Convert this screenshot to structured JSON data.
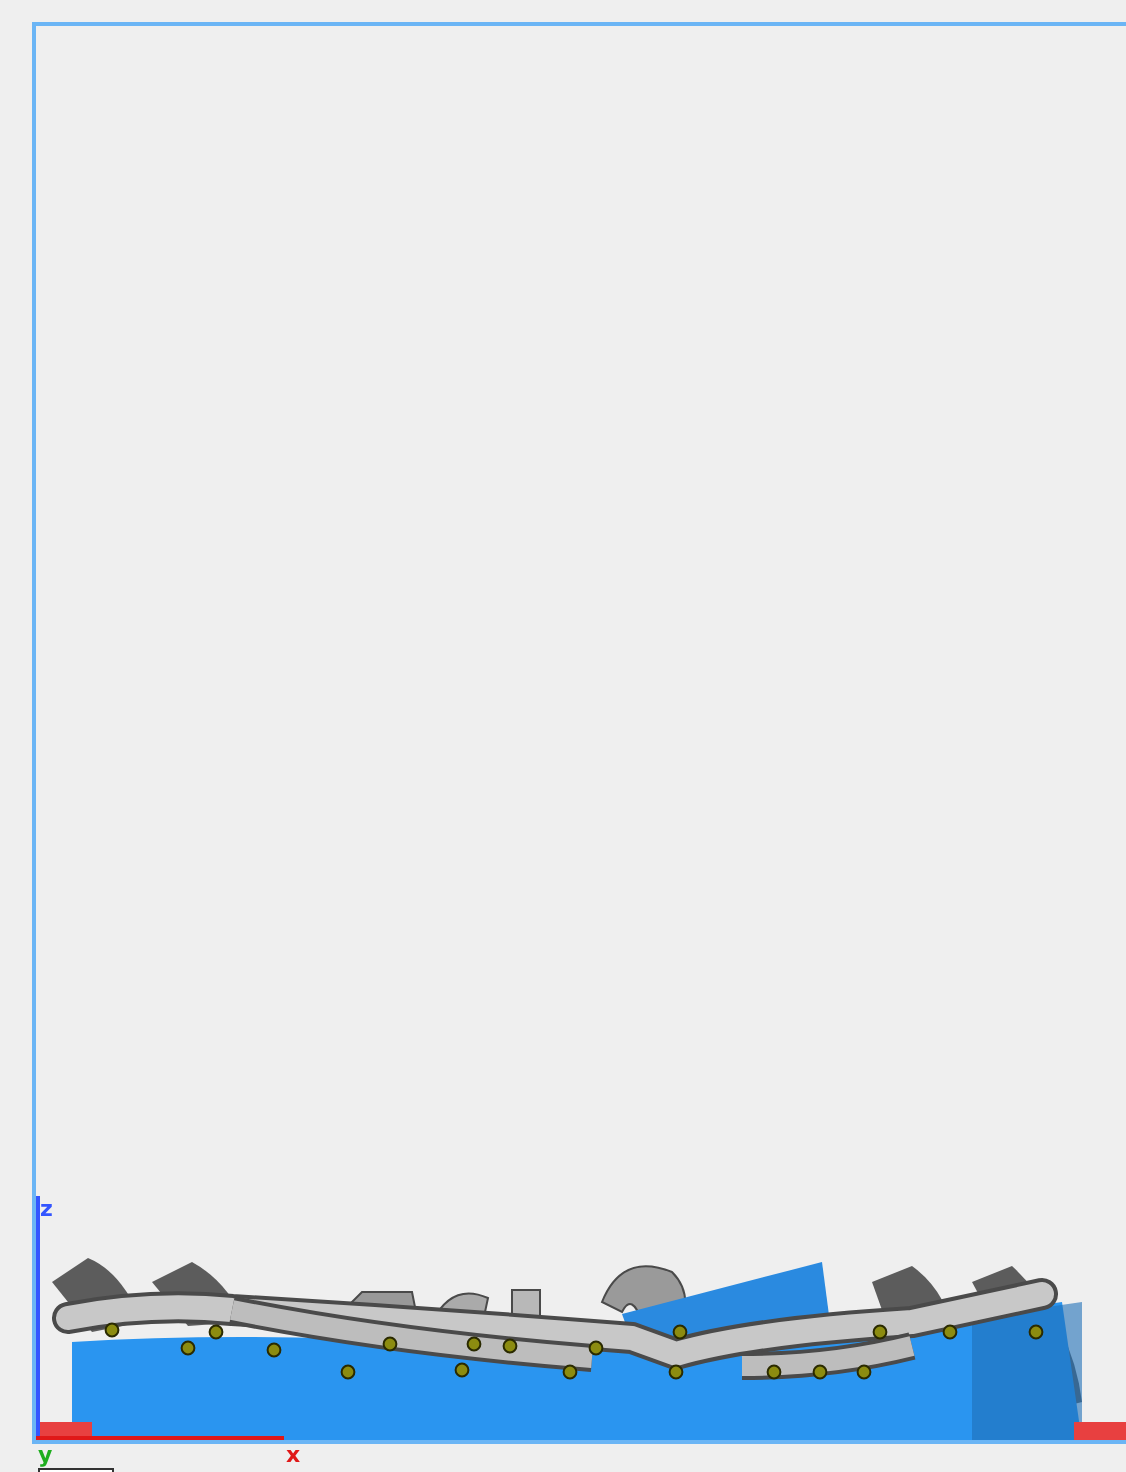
{
  "viewport": {
    "axes": [
      {
        "kind": "z",
        "label": "z",
        "color": "#3355ff"
      },
      {
        "kind": "x",
        "label": "x",
        "color": "#e01818"
      },
      {
        "kind": "y",
        "label": "y",
        "color": "#1fae1f"
      }
    ]
  }
}
